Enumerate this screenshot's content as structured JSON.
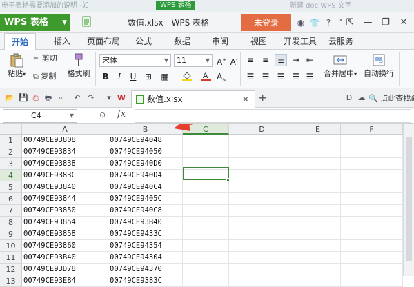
{
  "top_strip": {
    "left_text": "电子表格需要添加的说明 -如",
    "green_label": "WPS 表格",
    "right_text": "新建 doc WPS 文字"
  },
  "titlebar": {
    "app_name": "WPS 表格",
    "doc_title": "数值.xlsx - WPS 表格",
    "login_label": "未登录"
  },
  "menu": {
    "items": [
      "开始",
      "插入",
      "页面布局",
      "公式",
      "数据",
      "审阅",
      "视图",
      "开发工具",
      "云服务"
    ]
  },
  "ribbon": {
    "paste_label": "粘贴",
    "cut_label": "剪切",
    "copy_label": "复制",
    "format_painter_label": "格式刷",
    "font_name": "宋体",
    "font_size": "11",
    "bold": "B",
    "italic": "I",
    "underline": "U",
    "merge_label": "合并居中",
    "wrap_label": "自动换行",
    "colors": {
      "fill": "#f5d21b",
      "font": "#d23b2a"
    }
  },
  "quickbar": {
    "file_tab": "数值.xlsx",
    "search_label": "点此查找命令"
  },
  "formula_bar": {
    "name_box": "C4",
    "fx_label": "fx",
    "formula": ""
  },
  "grid": {
    "columns": [
      "A",
      "B",
      "C",
      "D",
      "E",
      "F"
    ],
    "rows": [
      {
        "n": "1",
        "a": "00749CE93808",
        "b": "00749CE94048"
      },
      {
        "n": "2",
        "a": "00749CE93834",
        "b": "00749CE94050"
      },
      {
        "n": "3",
        "a": "00749CE93838",
        "b": "00749CE940D0"
      },
      {
        "n": "4",
        "a": "00749CE9383C",
        "b": "00749CE940D4"
      },
      {
        "n": "5",
        "a": "00749CE93840",
        "b": "00749CE940C4"
      },
      {
        "n": "6",
        "a": "00749CE93844",
        "b": "00749CE9405C"
      },
      {
        "n": "7",
        "a": "00749CE93850",
        "b": "00749CE940C8"
      },
      {
        "n": "8",
        "a": "00749CE93854",
        "b": "00749CE93B40"
      },
      {
        "n": "9",
        "a": "00749CE93858",
        "b": "00749CE9433C"
      },
      {
        "n": "10",
        "a": "00749CE93860",
        "b": "00749CE94354"
      },
      {
        "n": "11",
        "a": "00749CE93B40",
        "b": "00749CE94304"
      },
      {
        "n": "12",
        "a": "00749CE93D78",
        "b": "00749CE94370"
      },
      {
        "n": "13",
        "a": "00749CE93E84",
        "b": "00749CE9383C"
      }
    ],
    "selected_cell": "C4",
    "arrow_color": "#e53d2e"
  }
}
